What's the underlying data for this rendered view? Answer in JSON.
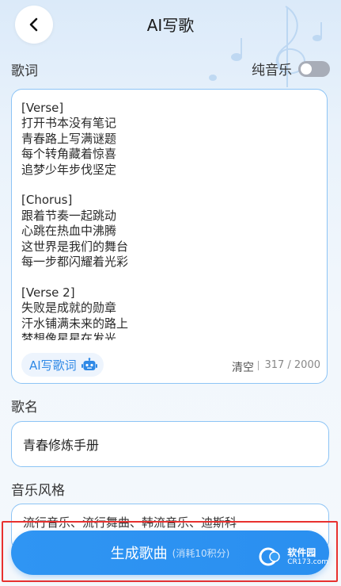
{
  "header": {
    "title": "AI写歌"
  },
  "lyrics": {
    "label": "歌词",
    "text": "[Verse]\n打开书本没有笔记\n青春路上写满谜题\n每个转角藏着惊喜\n追梦少年步伐坚定\n\n[Chorus]\n跟着节奏一起跳动\n心跳在热血中沸腾\n这世界是我们的舞台\n每一步都闪耀着光彩\n\n[Verse 2]\n失败是成就的勋章\n汗水铺满未来的路上\n梦想像星星在发光\n脚步越快越接近曙光",
    "ai_button_label": "AI写歌词",
    "clear_label": "清空",
    "counter": "317 / 2000"
  },
  "pure_music": {
    "label": "纯音乐",
    "enabled": false
  },
  "song_name": {
    "label": "歌名",
    "value": "青春修炼手册"
  },
  "music_style": {
    "label": "音乐风格",
    "value": "流行音乐、流行舞曲、韩流音乐、迪斯科"
  },
  "generate": {
    "label": "生成歌曲",
    "sub_label": "(消耗10积分)"
  },
  "watermark": {
    "text": "软件园",
    "sub": "CR173.com"
  },
  "colors": {
    "accent": "#2f95f3",
    "border": "#8dc4f5",
    "highlight": "#e8312f"
  },
  "icons": [
    "chevron-left-icon",
    "music-note-icon",
    "robot-icon"
  ]
}
